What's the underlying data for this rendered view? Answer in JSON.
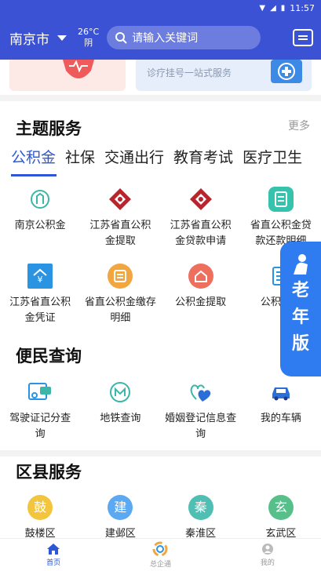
{
  "status_bar": {
    "time": "11:57"
  },
  "header": {
    "city": "南京市",
    "temperature": "26°C",
    "weather": "阴",
    "search_placeholder": "请输入关键词"
  },
  "banners": {
    "right_text": "诊疗挂号一站式服务"
  },
  "theme_services": {
    "title": "主题服务",
    "more": "更多",
    "tabs": [
      "公积金",
      "社保",
      "交通出行",
      "教育考试",
      "医疗卫生"
    ],
    "active_tab": "公积金",
    "items": [
      {
        "label": "南京公积金",
        "icon": "housing-fund-icon",
        "color": "#3cb6a8"
      },
      {
        "label": "江苏省直公积金提取",
        "icon": "gov-emblem-icon",
        "color": "#b8252d"
      },
      {
        "label": "江苏省直公积金贷款申请",
        "icon": "gov-emblem-icon",
        "color": "#b8252d"
      },
      {
        "label": "省直公积金贷款还款明细",
        "icon": "document-icon",
        "color": "#35c3ae"
      },
      {
        "label": "江苏省直公积金凭证",
        "icon": "yuan-house-icon",
        "color": "#2a94e3"
      },
      {
        "label": "省直公积金缴存明细",
        "icon": "list-icon",
        "color": "#f1a640"
      },
      {
        "label": "公积金提取",
        "icon": "house-withdraw-icon",
        "color": "#ef6f5f"
      },
      {
        "label": "公积金提",
        "icon": "id-card-icon",
        "color": "#2a94e3"
      }
    ]
  },
  "convenience": {
    "title": "便民查询",
    "items": [
      {
        "label": "驾驶证记分查询",
        "icon": "driver-license-icon",
        "color": "#2a94e3"
      },
      {
        "label": "地铁查询",
        "icon": "metro-icon",
        "color": "#3cb6a8"
      },
      {
        "label": "婚姻登记信息查询",
        "icon": "marriage-icon",
        "color": "#3cb6a8"
      },
      {
        "label": "我的车辆",
        "icon": "car-icon",
        "color": "#2a6fd8"
      }
    ]
  },
  "district": {
    "title": "区县服务",
    "items": [
      {
        "label": "鼓楼区",
        "char": "鼓",
        "color": "#f2c53d"
      },
      {
        "label": "建邺区",
        "char": "建",
        "color": "#5aa9f2"
      },
      {
        "label": "秦淮区",
        "char": "秦",
        "color": "#4fbfb3"
      },
      {
        "label": "玄武区",
        "char": "玄",
        "color": "#57c08a"
      }
    ]
  },
  "elder_mode": {
    "label_chars": [
      "老",
      "年",
      "版"
    ]
  },
  "bottom_nav": [
    {
      "label": "首页",
      "icon": "home-icon",
      "active": true
    },
    {
      "label": "总企通",
      "icon": "hub-logo-icon",
      "active": false
    },
    {
      "label": "我的",
      "icon": "user-icon",
      "active": false
    }
  ]
}
